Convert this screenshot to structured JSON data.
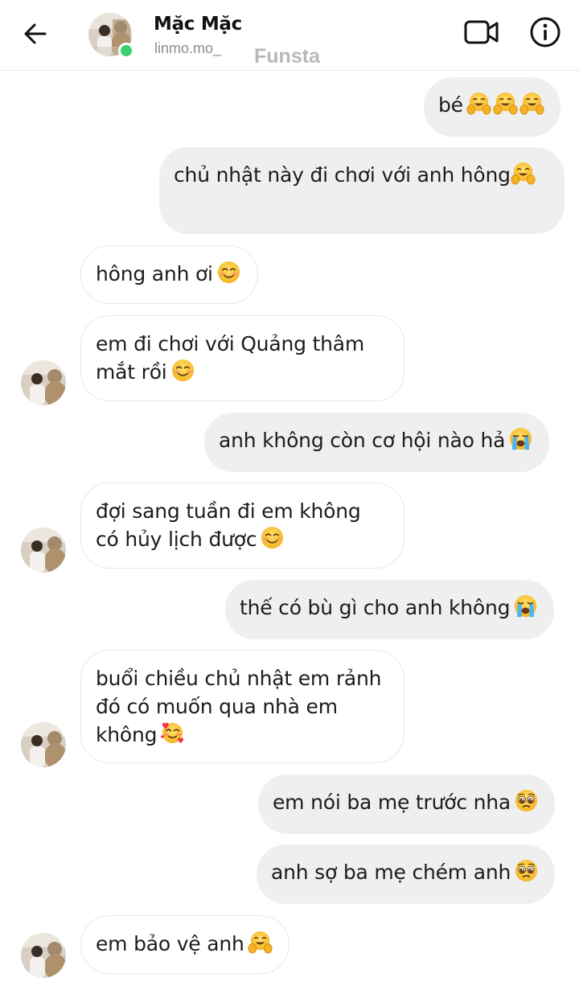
{
  "header": {
    "name": "Mặc Mặc",
    "username": "linmo.mo_",
    "watermark": "Funsta",
    "online_color": "#3bd16f"
  },
  "icons": {
    "back": "arrow-left-icon",
    "video": "video-camera-icon",
    "info": "info-circle-icon"
  },
  "messages": [
    {
      "sender": "me",
      "text": "bé",
      "emoji": [
        "hugging-face",
        "hugging-face",
        "hugging-face"
      ]
    },
    {
      "sender": "me",
      "text": "chủ nhật này đi chơi với anh hông",
      "emoji": [
        "hugging-face"
      ]
    },
    {
      "sender": "them",
      "text": "hông anh ơi",
      "emoji": [
        "smiling-face"
      ]
    },
    {
      "sender": "them",
      "text": "em đi chơi với Quảng thâm mắt rồi",
      "emoji": [
        "smiling-face"
      ]
    },
    {
      "sender": "me",
      "text": "anh không còn cơ hội nào hả",
      "emoji": [
        "loudly-crying-face"
      ]
    },
    {
      "sender": "them",
      "text": "đợi sang tuần đi em không có hủy lịch được",
      "emoji": [
        "smiling-face"
      ]
    },
    {
      "sender": "me",
      "text": "thế có bù gì cho anh không",
      "emoji": [
        "loudly-crying-face"
      ]
    },
    {
      "sender": "them",
      "text": "buổi chiều chủ nhật em rảnh đó có muốn qua nhà em không",
      "emoji": [
        "smiling-face-with-hearts"
      ]
    },
    {
      "sender": "me",
      "text": "em nói ba mẹ trước nha",
      "emoji": [
        "pleading-face"
      ]
    },
    {
      "sender": "me",
      "text": "anh sợ ba mẹ chém anh",
      "emoji": [
        "pleading-face"
      ]
    },
    {
      "sender": "them",
      "text": "em bảo vệ anh",
      "emoji": [
        "hugging-face"
      ]
    }
  ],
  "colors": {
    "outgoing_bubble": "#efefef",
    "incoming_bubble": "#ffffff",
    "text": "#1c1c1c"
  }
}
